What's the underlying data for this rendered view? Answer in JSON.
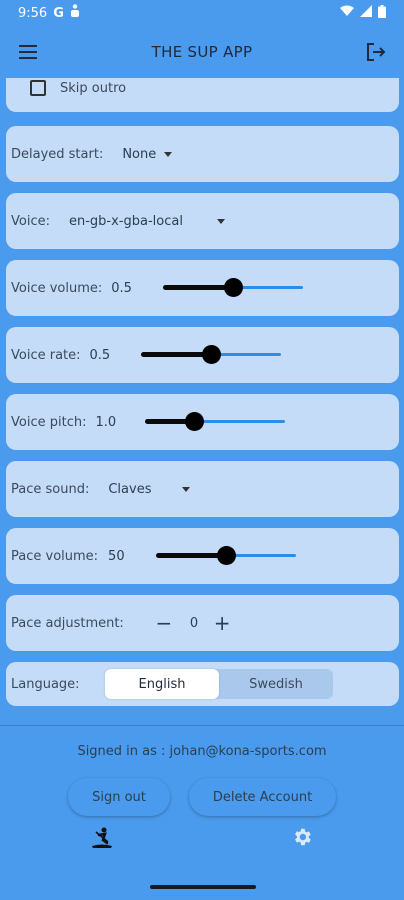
{
  "status_bar": {
    "time": "9:56",
    "g_letter": "G"
  },
  "app_bar": {
    "title": "THE SUP APP"
  },
  "settings": {
    "skip_outro": {
      "label": "Skip outro",
      "checked": false
    },
    "delayed_start": {
      "label": "Delayed start:",
      "value": "None"
    },
    "voice": {
      "label": "Voice:",
      "value": "en-gb-x-gba-local"
    },
    "voice_volume": {
      "label": "Voice volume:",
      "value_text": "0.5",
      "level": 0.5
    },
    "voice_rate": {
      "label": "Voice rate:",
      "value_text": "0.5",
      "level": 0.5
    },
    "voice_pitch": {
      "label": "Voice pitch:",
      "value_text": "1.0",
      "level": 0.33
    },
    "pace_sound": {
      "label": "Pace sound:",
      "value": "Claves"
    },
    "pace_volume": {
      "label": "Pace volume:",
      "value_text": "50",
      "level": 0.5
    },
    "pace_adjustment": {
      "label": "Pace adjustment:",
      "value": "0",
      "minus": "−",
      "plus": "+"
    },
    "language": {
      "label": "Language:",
      "options": [
        "English",
        "Swedish"
      ],
      "selected": "English"
    }
  },
  "account": {
    "signed_in": "Signed in as : johan@kona-sports.com",
    "sign_out": "Sign out",
    "delete_account": "Delete Account"
  },
  "bottom_nav": {
    "left_icon": "paddler-icon",
    "right_icon": "gear-icon"
  },
  "colors": {
    "background": "#4a9bed",
    "card": "#c4dcf8",
    "slider_active": "#0a0a0a",
    "slider_inactive": "#2a8ee8"
  }
}
